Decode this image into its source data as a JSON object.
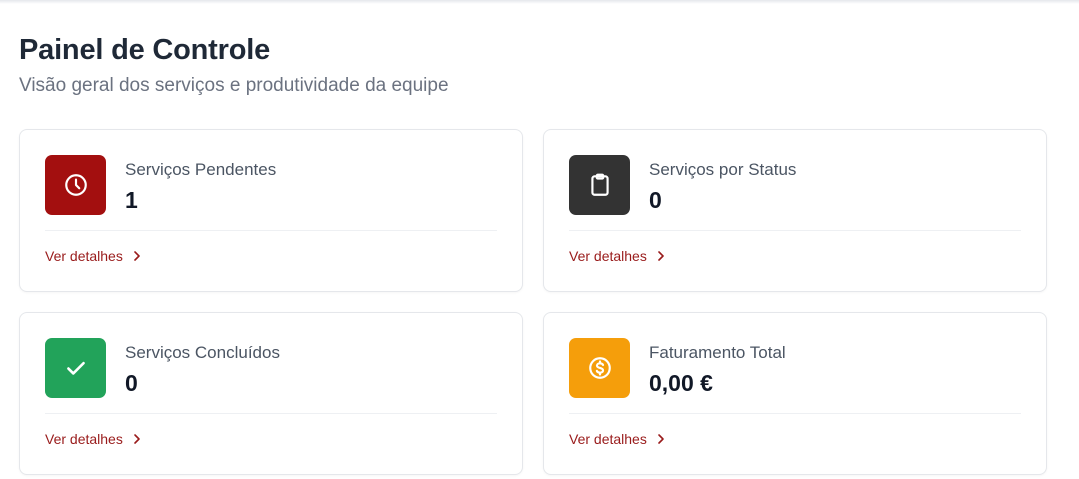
{
  "header": {
    "title": "Painel de Controle",
    "subtitle": "Visão geral dos serviços e produtividade da equipe"
  },
  "cards": [
    {
      "label": "Serviços Pendentes",
      "value": "1",
      "link": "Ver detalhes",
      "icon": "clock-icon",
      "color": "#a30f0f"
    },
    {
      "label": "Serviços por Status",
      "value": "0",
      "link": "Ver detalhes",
      "icon": "clipboard-icon",
      "color": "#333333"
    },
    {
      "label": "Serviços Concluídos",
      "value": "0",
      "link": "Ver detalhes",
      "icon": "check-icon",
      "color": "#22a35a"
    },
    {
      "label": "Faturamento Total",
      "value": "0,00 €",
      "link": "Ver detalhes",
      "icon": "dollar-coin-icon",
      "color": "#f59e0b"
    }
  ]
}
